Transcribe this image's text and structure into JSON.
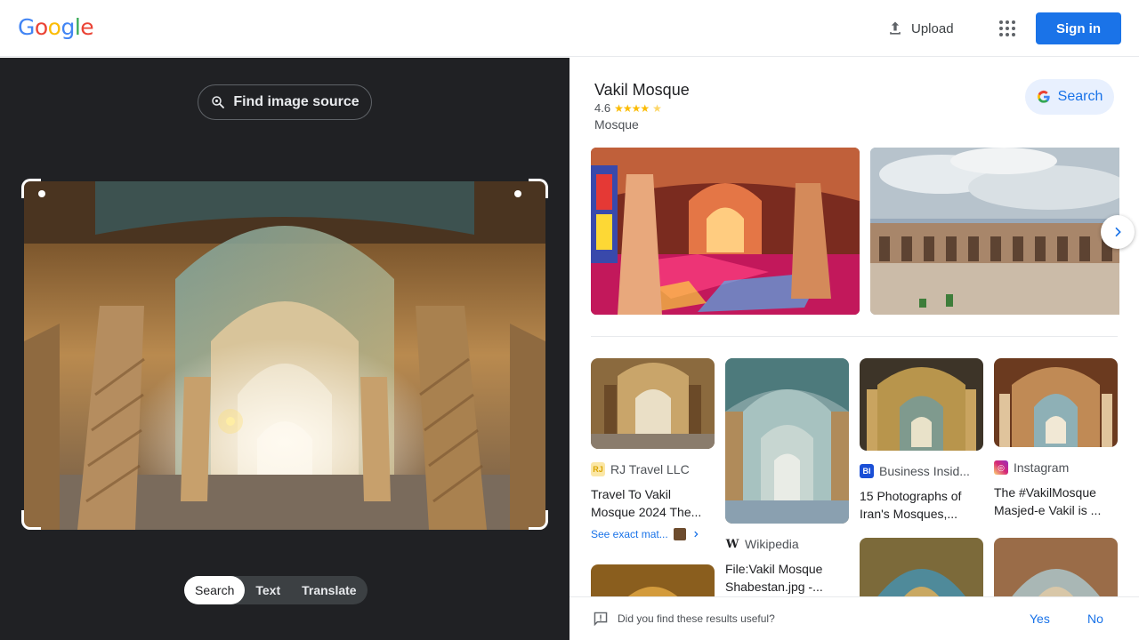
{
  "header": {
    "logo_letters": [
      {
        "ch": "G",
        "color": "#4285F4"
      },
      {
        "ch": "o",
        "color": "#EA4335"
      },
      {
        "ch": "o",
        "color": "#FBBC05"
      },
      {
        "ch": "g",
        "color": "#4285F4"
      },
      {
        "ch": "l",
        "color": "#34A853"
      },
      {
        "ch": "e",
        "color": "#EA4335"
      }
    ],
    "upload_label": "Upload",
    "signin_label": "Sign in"
  },
  "lens": {
    "find_source_label": "Find image source",
    "modes": [
      "Search",
      "Text",
      "Translate"
    ],
    "active_mode": "Search"
  },
  "knowledge_panel": {
    "title": "Vakil Mosque",
    "rating": "4.6",
    "stars": 4.6,
    "type": "Mosque",
    "search_label": "Search"
  },
  "results": [
    {
      "source": "RJ Travel LLC",
      "title_l1": "Travel To Vakil",
      "title_l2": "Mosque 2024 The...",
      "exact_label": "See exact mat...",
      "fav_bg": "#fbe7a6",
      "fav_fg": "#d9a400",
      "fav_text": "RJ"
    },
    {
      "source": "Wikipedia",
      "title_l1": "File:Vakil Mosque",
      "title_l2": "Shabestan.jpg -...",
      "fav_bg": "#ffffff",
      "fav_fg": "#202124",
      "fav_text": "W"
    },
    {
      "source": "Business Insid...",
      "title_l1": "15 Photographs of",
      "title_l2": "Iran's Mosques,...",
      "fav_bg": "#1a4fd6",
      "fav_fg": "#ffffff",
      "fav_text": "BI"
    },
    {
      "source": "Instagram",
      "title_l1": "The #VakilMosque",
      "title_l2": "Masjed-e Vakil is ...",
      "fav_bg": "#dd2a7b",
      "fav_fg": "#ffffff",
      "fav_text": "◎"
    }
  ],
  "feedback": {
    "question": "Did you find these results useful?",
    "yes": "Yes",
    "no": "No"
  }
}
